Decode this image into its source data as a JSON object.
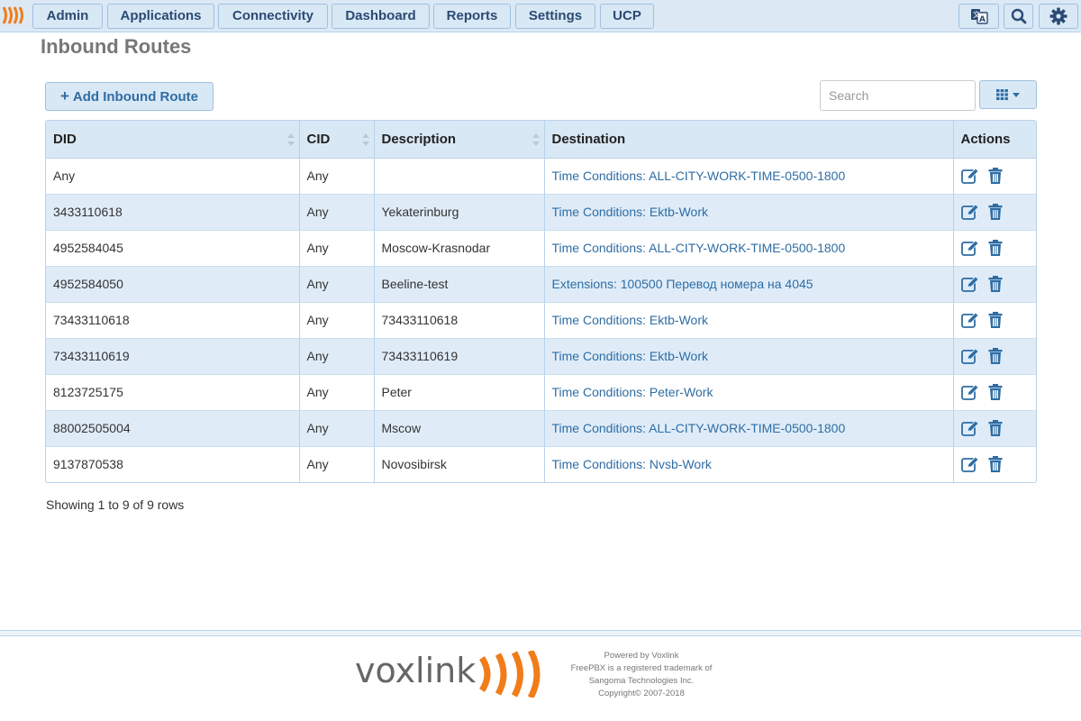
{
  "nav": {
    "items": [
      {
        "label": "Admin"
      },
      {
        "label": "Applications"
      },
      {
        "label": "Connectivity"
      },
      {
        "label": "Dashboard"
      },
      {
        "label": "Reports"
      },
      {
        "label": "Settings"
      },
      {
        "label": "UCP"
      }
    ],
    "icons": [
      "language-icon",
      "search-icon",
      "gear-icon"
    ]
  },
  "page": {
    "title": "Inbound Routes",
    "add_button_label": "Add Inbound Route",
    "search_placeholder": "Search"
  },
  "table": {
    "columns": [
      "DID",
      "CID",
      "Description",
      "Destination",
      "Actions"
    ],
    "rows": [
      {
        "did": "Any",
        "cid": "Any",
        "description": "",
        "destination": "Time Conditions: ALL-CITY-WORK-TIME-0500-1800"
      },
      {
        "did": "3433110618",
        "cid": "Any",
        "description": "Yekaterinburg",
        "destination": "Time Conditions: Ektb-Work"
      },
      {
        "did": "4952584045",
        "cid": "Any",
        "description": "Moscow-Krasnodar",
        "destination": "Time Conditions: ALL-CITY-WORK-TIME-0500-1800"
      },
      {
        "did": "4952584050",
        "cid": "Any",
        "description": "Beeline-test",
        "destination": "Extensions: 100500 Перевод номера на 4045"
      },
      {
        "did": "73433110618",
        "cid": "Any",
        "description": "73433110618",
        "destination": "Time Conditions: Ektb-Work"
      },
      {
        "did": "73433110619",
        "cid": "Any",
        "description": "73433110619",
        "destination": "Time Conditions: Ektb-Work"
      },
      {
        "did": "8123725175",
        "cid": "Any",
        "description": "Peter",
        "destination": "Time Conditions: Peter-Work"
      },
      {
        "did": "88002505004",
        "cid": "Any",
        "description": "Mscow",
        "destination": "Time Conditions: ALL-CITY-WORK-TIME-0500-1800"
      },
      {
        "did": "9137870538",
        "cid": "Any",
        "description": "Novosibirsk",
        "destination": "Time Conditions: Nvsb-Work"
      }
    ]
  },
  "pagination": {
    "summary": "Showing 1 to 9 of 9 rows"
  },
  "footer": {
    "brand": "voxlink",
    "lines": [
      "Powered by Voxlink",
      "FreePBX is a registered trademark of",
      "Sangoma Technologies Inc.",
      "Copyright© 2007-2018"
    ]
  },
  "colors": {
    "accent": "#2e6da4",
    "header_bg": "#d9e8f5",
    "brand_orange": "#f07d1a"
  }
}
